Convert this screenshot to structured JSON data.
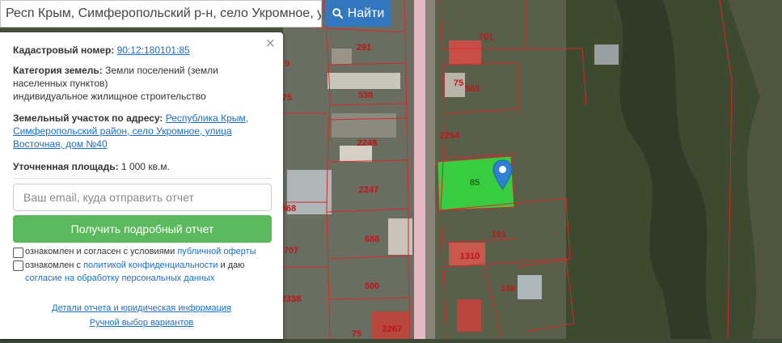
{
  "search": {
    "value": "Респ Крым, Симферопольский р-н, село Укромное, ул Вос",
    "button_label": "Найти",
    "button_icon": "search-icon"
  },
  "panel": {
    "close_icon": "close-icon",
    "cadastral_label": "Кадастровый номер:",
    "cadastral_value": "90:12:180101:85",
    "category_label": "Категория земель:",
    "category_value": "Земли поселений (земли",
    "category_value_2": "населенных пунктов)",
    "category_value_3": "индивидуальное жилищное строительство",
    "address_label": "Земельный участок по адресу:",
    "address_value_1": "Республика Крым,",
    "address_value_2": "Симферопольский район, село Укромное, улица",
    "address_value_3": "Восточная, дом №40",
    "area_label": "Уточненная площадь:",
    "area_value": "1 000 кв.м.",
    "email_placeholder": "Ваш email, куда отправить отчет",
    "report_button": "Получить подробный отчет",
    "consent1_text": "ознакомлен и согласен с условиями ",
    "consent1_link": "публичной оферты",
    "consent2_text": "ознакомлен с ",
    "consent2_link": "политикой конфиденциальности",
    "consent2_tail": " и даю",
    "consent2_link2": "согласие на обработку персональных данных",
    "footer_link1": "Детали отчета и юридическая информация",
    "footer_link2": "Ручной выбор вариантов"
  },
  "map": {
    "parcel_labels": [
      "291",
      "538",
      "2248",
      "2247",
      "688",
      "500",
      "2267",
      "701",
      "75",
      "503",
      "2254",
      "85",
      "191",
      "1310",
      "146",
      "75",
      "368",
      "707",
      "2338",
      "75",
      "9",
      "75",
      "191",
      "2254",
      "380"
    ],
    "selected_parcel": "85",
    "marker_icon": "map-pin-icon",
    "selected_color": "#33e040",
    "boundary_color": "#d8262b",
    "road_color": "#e9b8c6"
  }
}
